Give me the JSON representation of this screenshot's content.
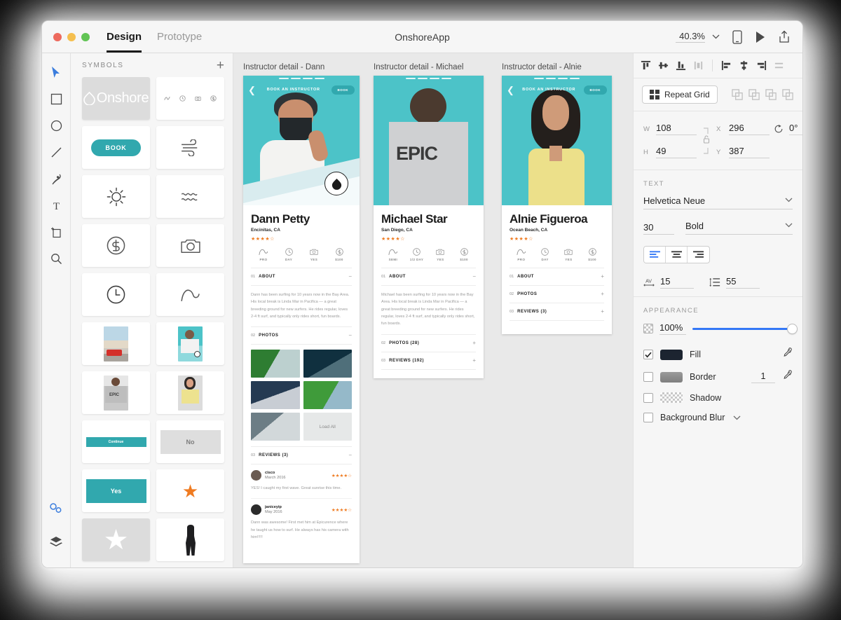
{
  "window": {
    "document_title": "OnshoreApp",
    "mode_tabs": [
      {
        "label": "Design",
        "active": true
      },
      {
        "label": "Prototype",
        "active": false
      }
    ],
    "zoom_level": "40.3%",
    "traffic_lights": [
      "close-button",
      "minimize-button",
      "maximize-button"
    ],
    "right_tools": [
      "device-preview-icon",
      "play-icon",
      "share-icon"
    ]
  },
  "tools": {
    "items": [
      {
        "name": "select-tool",
        "active": true
      },
      {
        "name": "rectangle-tool",
        "active": false
      },
      {
        "name": "ellipse-tool",
        "active": false
      },
      {
        "name": "line-tool",
        "active": false
      },
      {
        "name": "pen-tool",
        "active": false
      },
      {
        "name": "text-tool",
        "active": false
      },
      {
        "name": "artboard-tool",
        "active": false
      },
      {
        "name": "zoom-tool",
        "active": false
      }
    ],
    "bottom": [
      {
        "name": "symbols-panel-icon",
        "active": true
      },
      {
        "name": "layers-panel-icon",
        "active": false
      }
    ]
  },
  "symbols_panel": {
    "title": "SYMBOLS",
    "add_label": "+",
    "items": [
      {
        "name": "logo-symbol",
        "kind": "logo",
        "label": "Onshore"
      },
      {
        "name": "icon-row-symbol",
        "kind": "iconrow"
      },
      {
        "name": "book-button-symbol",
        "kind": "pill",
        "label": "BOOK"
      },
      {
        "name": "wind-icon-symbol",
        "kind": "wind"
      },
      {
        "name": "sun-icon-symbol",
        "kind": "sun"
      },
      {
        "name": "waves-icon-symbol",
        "kind": "waves"
      },
      {
        "name": "dollar-icon-symbol",
        "kind": "dollar"
      },
      {
        "name": "camera-icon-symbol",
        "kind": "camera"
      },
      {
        "name": "clock-icon-symbol",
        "kind": "clock"
      },
      {
        "name": "wave-icon-symbol",
        "kind": "wave"
      },
      {
        "name": "street-photo-symbol",
        "kind": "photo-street"
      },
      {
        "name": "surfer-photo-symbol",
        "kind": "photo-surfer"
      },
      {
        "name": "epic-photo-symbol",
        "kind": "photo-epic"
      },
      {
        "name": "alnie-photo-symbol",
        "kind": "photo-alnie"
      },
      {
        "name": "continue-button-symbol",
        "kind": "btn-small",
        "label": "Continue"
      },
      {
        "name": "no-button-symbol",
        "kind": "btn-grey",
        "label": "No"
      },
      {
        "name": "yes-button-symbol",
        "kind": "btn-teal",
        "label": "Yes"
      },
      {
        "name": "orange-star-symbol",
        "kind": "star-orange"
      },
      {
        "name": "white-star-symbol",
        "kind": "star-white"
      },
      {
        "name": "wetsuit-symbol",
        "kind": "wetsuit"
      }
    ]
  },
  "canvas": {
    "artboards": [
      {
        "label": "Instructor detail - Dann",
        "nav_title": "BOOK AN INSTRUCTOR",
        "nav_button": "BOOK",
        "name": "Dann Petty",
        "location": "Encinitas, CA",
        "rating": "★★★★☆",
        "stats": [
          {
            "icon": "wave-icon",
            "label": "PRO"
          },
          {
            "icon": "clock-icon",
            "label": "DAY"
          },
          {
            "icon": "camera-icon",
            "label": "YES"
          },
          {
            "icon": "dollar-icon",
            "label": "$100"
          }
        ],
        "sections": [
          {
            "num": "01",
            "title": "ABOUT",
            "toggle": "−"
          },
          {
            "num": "02",
            "title": "PHOTOS",
            "toggle": "−"
          },
          {
            "num": "03",
            "title": "REVIEWS (3)",
            "toggle": "−"
          }
        ],
        "about_text": "Dann has been surfing for 10 years now in the Bay Area. His local break is Linda Mar in Pacifica — a great breeding ground for new surfers. He rides regular, loves 2-4 ft surf, and typically only rides short, fun boards.",
        "load_all_label": "Load All",
        "reviews": [
          {
            "author": "cisco",
            "date": "March 2016",
            "stars": "★★★★☆",
            "text": "YES! I caught my first wave. Great sunrise this time."
          },
          {
            "author": "janiceyip",
            "date": "May 2016",
            "stars": "★★★★☆",
            "text": "Dann was awesome! First met him at Epicurence where he taught us how to surf. He always has his camera with him!!!!!"
          }
        ]
      },
      {
        "label": "Instructor detail - Michael",
        "nav_title": "BOOK AN INSTRUCTOR",
        "nav_button": "BOOK",
        "name": "Michael Star",
        "location": "San Diego, CA",
        "rating": "★★★★☆",
        "stats": [
          {
            "icon": "wave-icon",
            "label": "SEMI"
          },
          {
            "icon": "clock-icon",
            "label": "1/2 DAY"
          },
          {
            "icon": "camera-icon",
            "label": "YES"
          },
          {
            "icon": "dollar-icon",
            "label": "$100"
          }
        ],
        "sections": [
          {
            "num": "01",
            "title": "ABOUT",
            "toggle": "−"
          },
          {
            "num": "02",
            "title": "PHOTOS (28)",
            "toggle": "+"
          },
          {
            "num": "03",
            "title": "REVIEWS (192)",
            "toggle": "+"
          }
        ],
        "about_text": "Michael has been surfing for 10 years now in the Bay Area. His local break is Linda Mar in Pacifica — a great breeding ground for new surfers. He rides regular, loves 2-4 ft surf, and typically only rides short, fun boards."
      },
      {
        "label": "Instructor detail - Alnie",
        "nav_title": "BOOK AN INSTRUCTOR",
        "nav_button": "BOOK",
        "name": "Alnie Figueroa",
        "location": "Ocean Beach, CA",
        "rating": "★★★★☆",
        "stats": [
          {
            "icon": "wave-icon",
            "label": "PRO"
          },
          {
            "icon": "clock-icon",
            "label": "DAY"
          },
          {
            "icon": "camera-icon",
            "label": "YES"
          },
          {
            "icon": "dollar-icon",
            "label": "$100"
          }
        ],
        "sections": [
          {
            "num": "01",
            "title": "ABOUT",
            "toggle": "+"
          },
          {
            "num": "02",
            "title": "PHOTOS",
            "toggle": "+"
          },
          {
            "num": "03",
            "title": "REVIEWS (3)",
            "toggle": "+"
          }
        ]
      }
    ]
  },
  "inspector": {
    "repeat_grid_label": "Repeat Grid",
    "transform": {
      "w_label": "W",
      "w_value": "108",
      "h_label": "H",
      "h_value": "49",
      "x_label": "X",
      "x_value": "296",
      "y_label": "Y",
      "y_value": "387",
      "rotation_value": "0°"
    },
    "text": {
      "title": "TEXT",
      "font_family": "Helvetica Neue",
      "font_size": "30",
      "font_weight": "Bold",
      "alignment": [
        "align-left",
        "align-center",
        "align-right"
      ],
      "alignment_selected": "align-left",
      "letter_spacing": "15",
      "line_height": "55"
    },
    "appearance": {
      "title": "APPEARANCE",
      "opacity": "100%",
      "fill": {
        "label": "Fill",
        "checked": true,
        "color": "#1c2430"
      },
      "border": {
        "label": "Border",
        "checked": false,
        "color": "#8a8a8a",
        "width": "1"
      },
      "shadow": {
        "label": "Shadow",
        "checked": false
      },
      "background_blur": {
        "label": "Background Blur",
        "checked": false
      }
    }
  },
  "colors": {
    "teal": "#4cc3c8",
    "teal_dark": "#31a8ae",
    "orange": "#ef7b21",
    "blue_accent": "#3478f6",
    "canvas_bg": "#e9e9e9"
  }
}
